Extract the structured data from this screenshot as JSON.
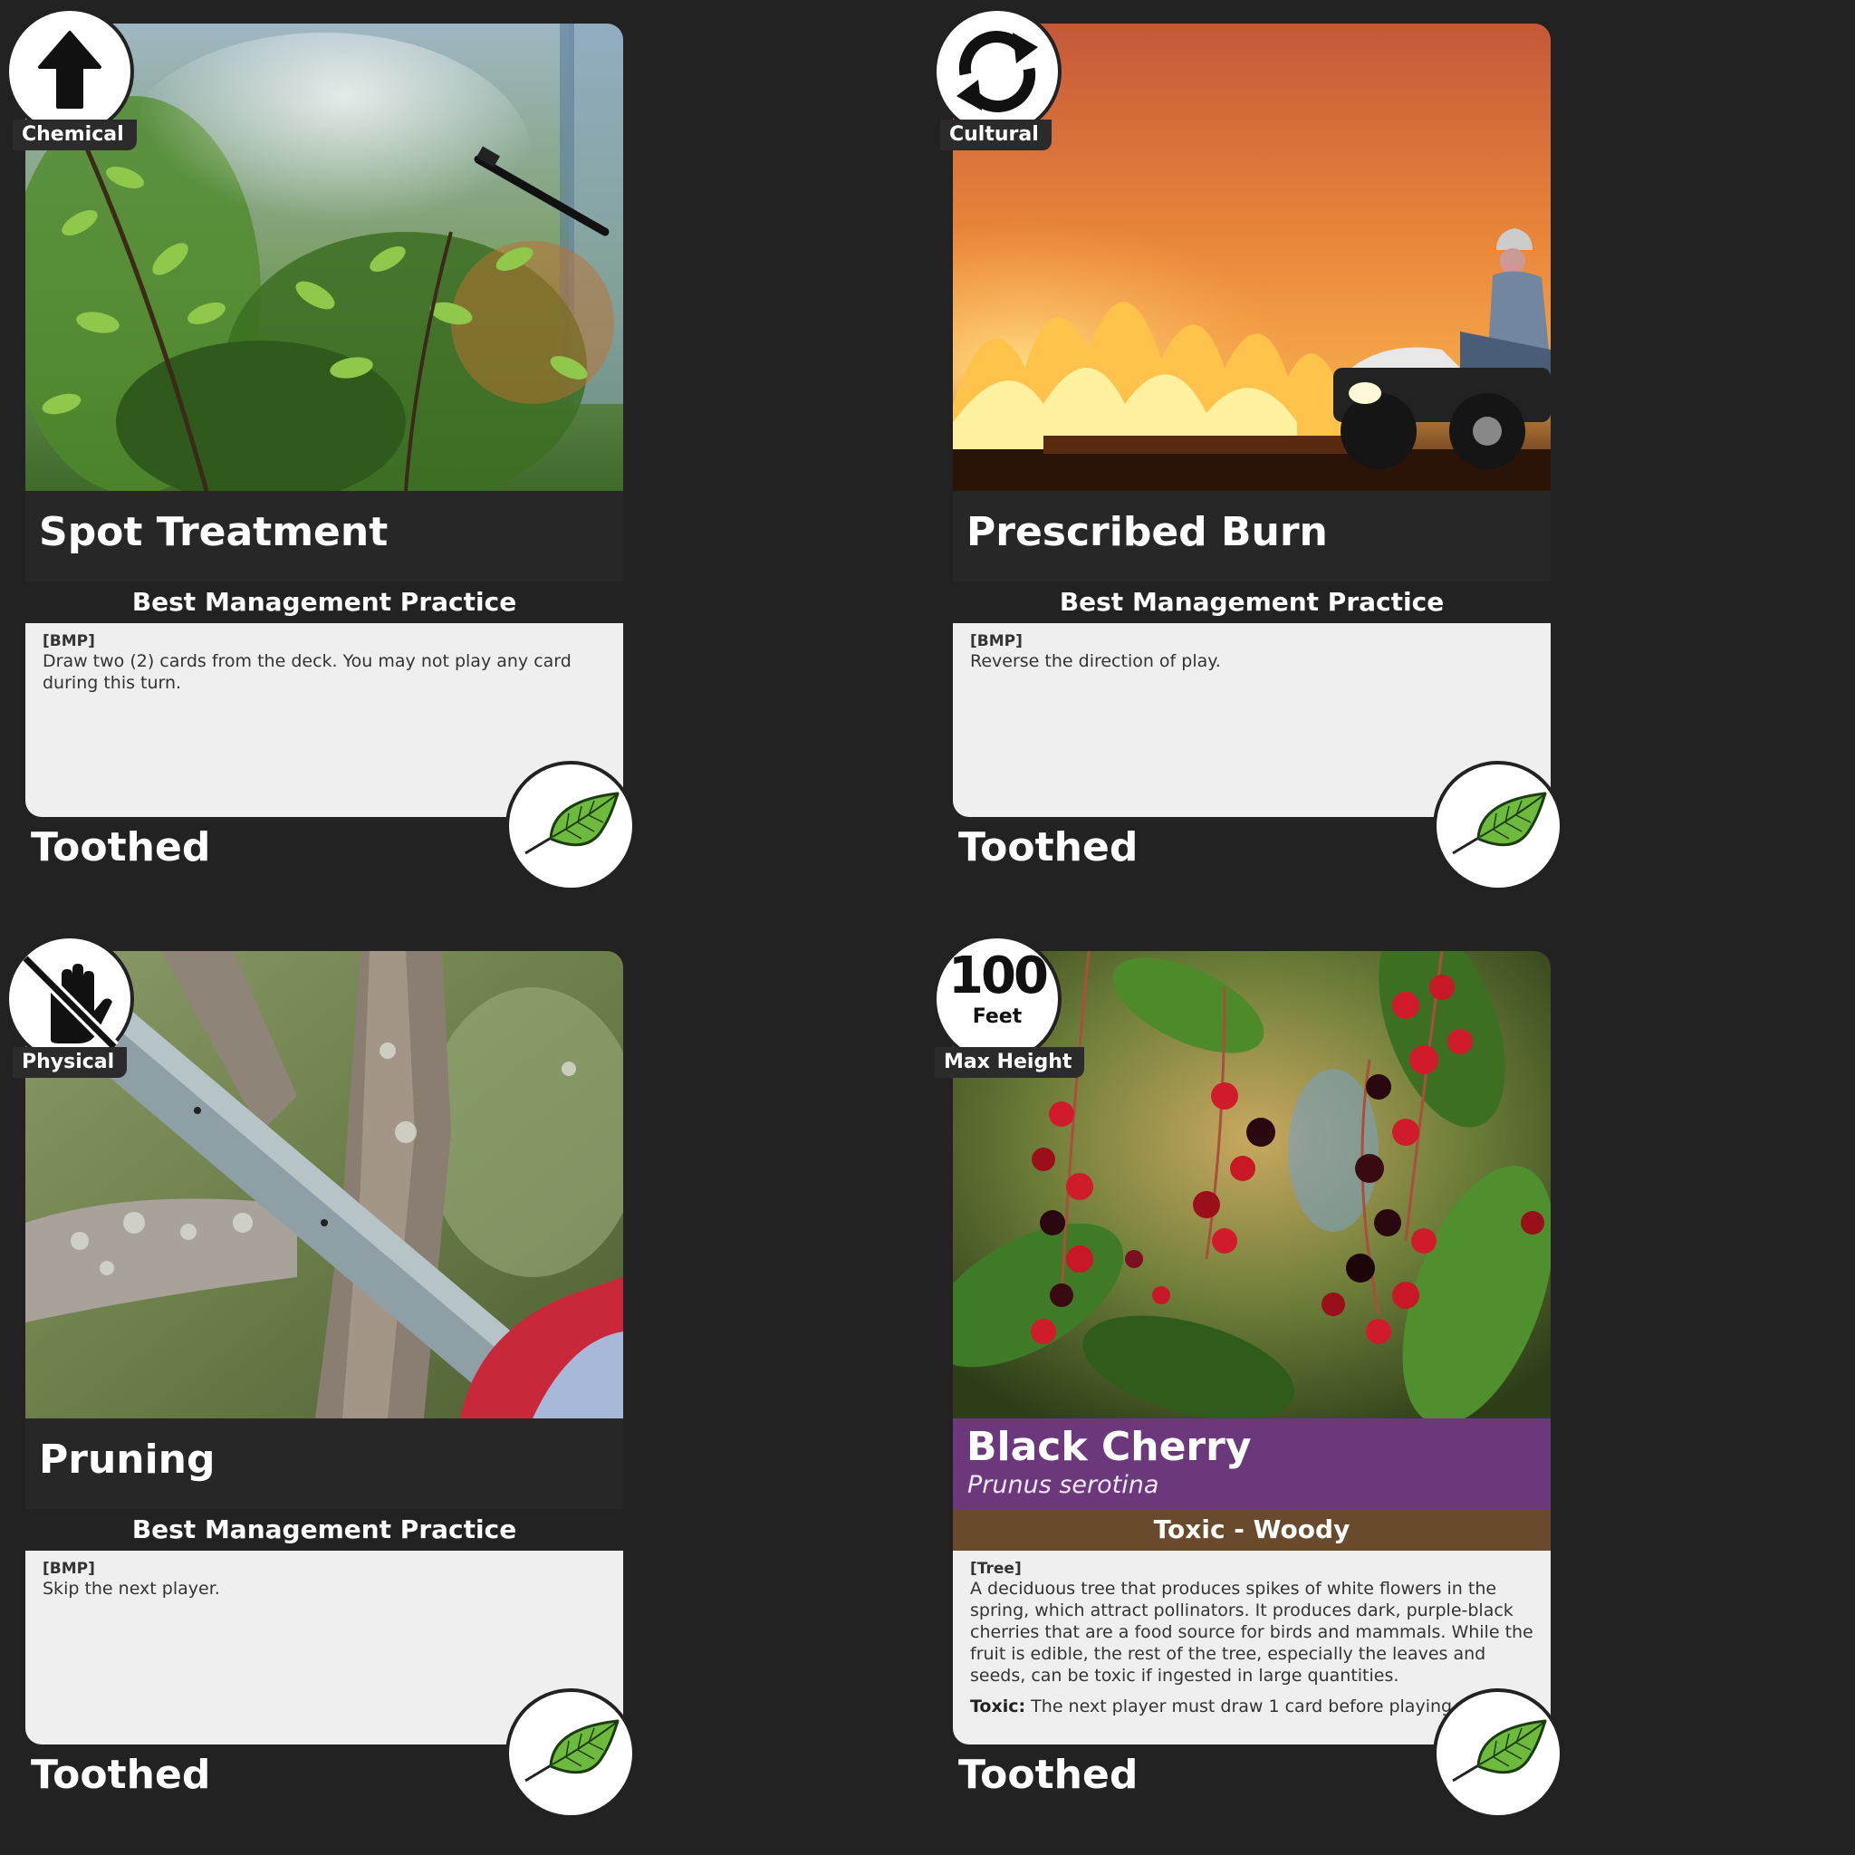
{
  "cards": [
    {
      "category": "Chemical",
      "category_icon": "arrow-up-icon",
      "title": "Spot Treatment",
      "card_type": "Best Management Practice",
      "tag": "[BMP]",
      "text": "Draw two (2) cards from the deck. You may not play any card during this turn.",
      "leaf_type": "Toothed",
      "photo": "herbicide sprayer mist over shrubs"
    },
    {
      "category": "Cultural",
      "category_icon": "cycle-arrows-icon",
      "title": "Prescribed Burn",
      "card_type": "Best Management Practice",
      "tag": "[BMP]",
      "text": "Reverse the direction of play.",
      "leaf_type": "Toothed",
      "photo": "field fire with person on ATV"
    },
    {
      "category": "Physical",
      "category_icon": "no-hand-icon",
      "title": "Pruning",
      "card_type": "Best Management Practice",
      "tag": "[BMP]",
      "text": "Skip the next player.",
      "leaf_type": "Toothed",
      "photo": "chainsaw cutting tree branch"
    },
    {
      "height_value": "100",
      "height_unit": "Feet",
      "category": "Max Height",
      "title": "Black Cherry",
      "scientific_name": "Prunus serotina",
      "card_type": "Toxic - Woody",
      "tag": "[Tree]",
      "text": "A deciduous tree that produces spikes of white flowers in the spring, which attract pollinators. It produces dark, purple-black cherries that are a food source for birds and mammals. While the fruit is edible, the rest of the tree, especially the leaves and seeds, can be toxic if ingested in large quantities.",
      "toxic_label": "Toxic:",
      "toxic_text": "The next player must draw 1 card before playing.",
      "leaf_type": "Toothed",
      "photo": "black cherry berries among leaves"
    }
  ],
  "colors": {
    "background": "#222222",
    "text_box": "#efefef",
    "woody_band": "#6a4a2c",
    "plant_title_band": "#783c8c",
    "leaf_green": "#5aa83a"
  }
}
